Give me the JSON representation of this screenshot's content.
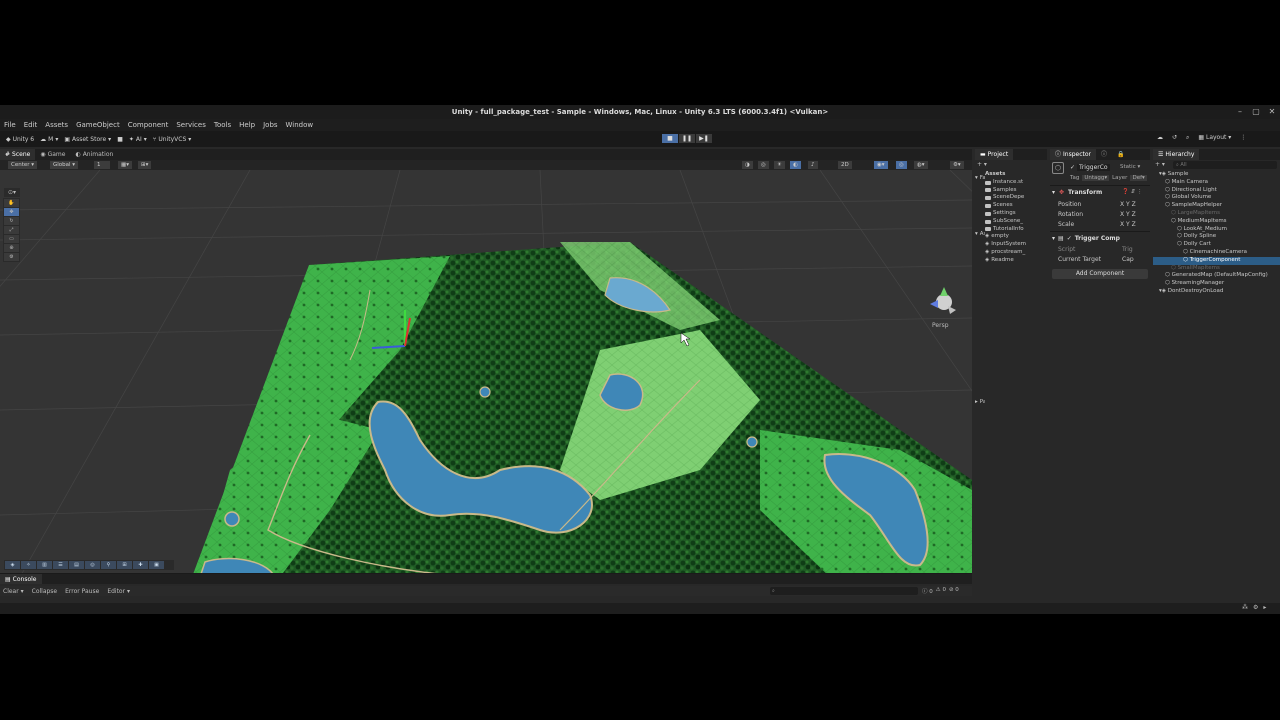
{
  "window": {
    "title": "Unity - full_package_test - Sample - Windows, Mac, Linux - Unity 6.3 LTS (6000.3.4f1) <Vulkan>"
  },
  "menu": [
    "File",
    "Edit",
    "Assets",
    "GameObject",
    "Component",
    "Services",
    "Tools",
    "Help",
    "Jobs",
    "Window"
  ],
  "toolbar": {
    "account": "Unity 6",
    "user": "M",
    "asset_store": "Asset Store",
    "ai": "AI",
    "vcs": "UnityVCS",
    "layout": "Layout"
  },
  "scene_tabs": [
    {
      "label": "Scene",
      "icon": "grid-icon"
    },
    {
      "label": "Game",
      "icon": "gamepad-icon"
    },
    {
      "label": "Animation",
      "icon": "animation-icon"
    }
  ],
  "scene_toolbar": {
    "pivot": "Center",
    "space": "Global",
    "grid_snap": "1",
    "view_mode": "Persp"
  },
  "console": {
    "tab": "Console",
    "buttons": [
      "Clear",
      "Collapse",
      "Error Pause",
      "Editor"
    ],
    "counts": [
      "0",
      "0",
      "0"
    ]
  },
  "project": {
    "tab": "Project",
    "root": "Assets",
    "items": [
      {
        "name": "Instance.st",
        "type": "folder"
      },
      {
        "name": "Samples",
        "type": "folder"
      },
      {
        "name": "SceneDepe",
        "type": "folder"
      },
      {
        "name": "Scenes",
        "type": "folder"
      },
      {
        "name": "Settings",
        "type": "folder"
      },
      {
        "name": "SubScene_",
        "type": "folder"
      },
      {
        "name": "TutorialInfo",
        "type": "folder"
      },
      {
        "name": "empty",
        "type": "asset"
      },
      {
        "name": "InputSystem",
        "type": "asset"
      },
      {
        "name": "procstream_",
        "type": "asset"
      },
      {
        "name": "Readme",
        "type": "asset"
      }
    ],
    "tree_labels": [
      "Fa",
      "As",
      "Pa"
    ]
  },
  "inspector": {
    "tab": "Inspector",
    "object_name": "TriggerCo",
    "static_label": "Static",
    "tag_label": "Tag",
    "tag_value": "Untagg",
    "layer_label": "Layer",
    "layer_value": "Def",
    "transform": {
      "title": "Transform",
      "rows": [
        {
          "label": "Position",
          "axes": "X  Y  Z"
        },
        {
          "label": "Rotation",
          "axes": "X  Y  Z"
        },
        {
          "label": "Scale",
          "axes": "X  Y  Z"
        }
      ]
    },
    "trigger": {
      "title": "Trigger Comp",
      "script_label": "Script",
      "script_value": "Trig",
      "target_label": "Current Target",
      "target_value": "Cap"
    },
    "add_component": "Add Component"
  },
  "hierarchy": {
    "tab": "Hierarchy",
    "search": "All",
    "items": [
      {
        "name": "Sample",
        "depth": 0,
        "state": "normal"
      },
      {
        "name": "Main Camera",
        "depth": 1,
        "state": "normal"
      },
      {
        "name": "Directional Light",
        "depth": 1,
        "state": "normal"
      },
      {
        "name": "Global Volume",
        "depth": 1,
        "state": "normal"
      },
      {
        "name": "SampleMapHelper",
        "depth": 1,
        "state": "normal"
      },
      {
        "name": "LargeMapItems",
        "depth": 2,
        "state": "dim"
      },
      {
        "name": "MediumMapItems",
        "depth": 2,
        "state": "normal"
      },
      {
        "name": "LookAt_Medium",
        "depth": 3,
        "state": "normal"
      },
      {
        "name": "Dolly Spline",
        "depth": 3,
        "state": "normal"
      },
      {
        "name": "Dolly Cart",
        "depth": 3,
        "state": "normal"
      },
      {
        "name": "CinemachineCamera",
        "depth": 4,
        "state": "normal"
      },
      {
        "name": "TriggerComponent",
        "depth": 4,
        "state": "selected"
      },
      {
        "name": "SmallMapItems",
        "depth": 2,
        "state": "dim"
      },
      {
        "name": "GeneratedMap (DefaultMapConfig)",
        "depth": 1,
        "state": "normal"
      },
      {
        "name": "StreamingManager",
        "depth": 1,
        "state": "normal"
      },
      {
        "name": "DontDestroyOnLoad",
        "depth": 0,
        "state": "normal"
      }
    ]
  }
}
